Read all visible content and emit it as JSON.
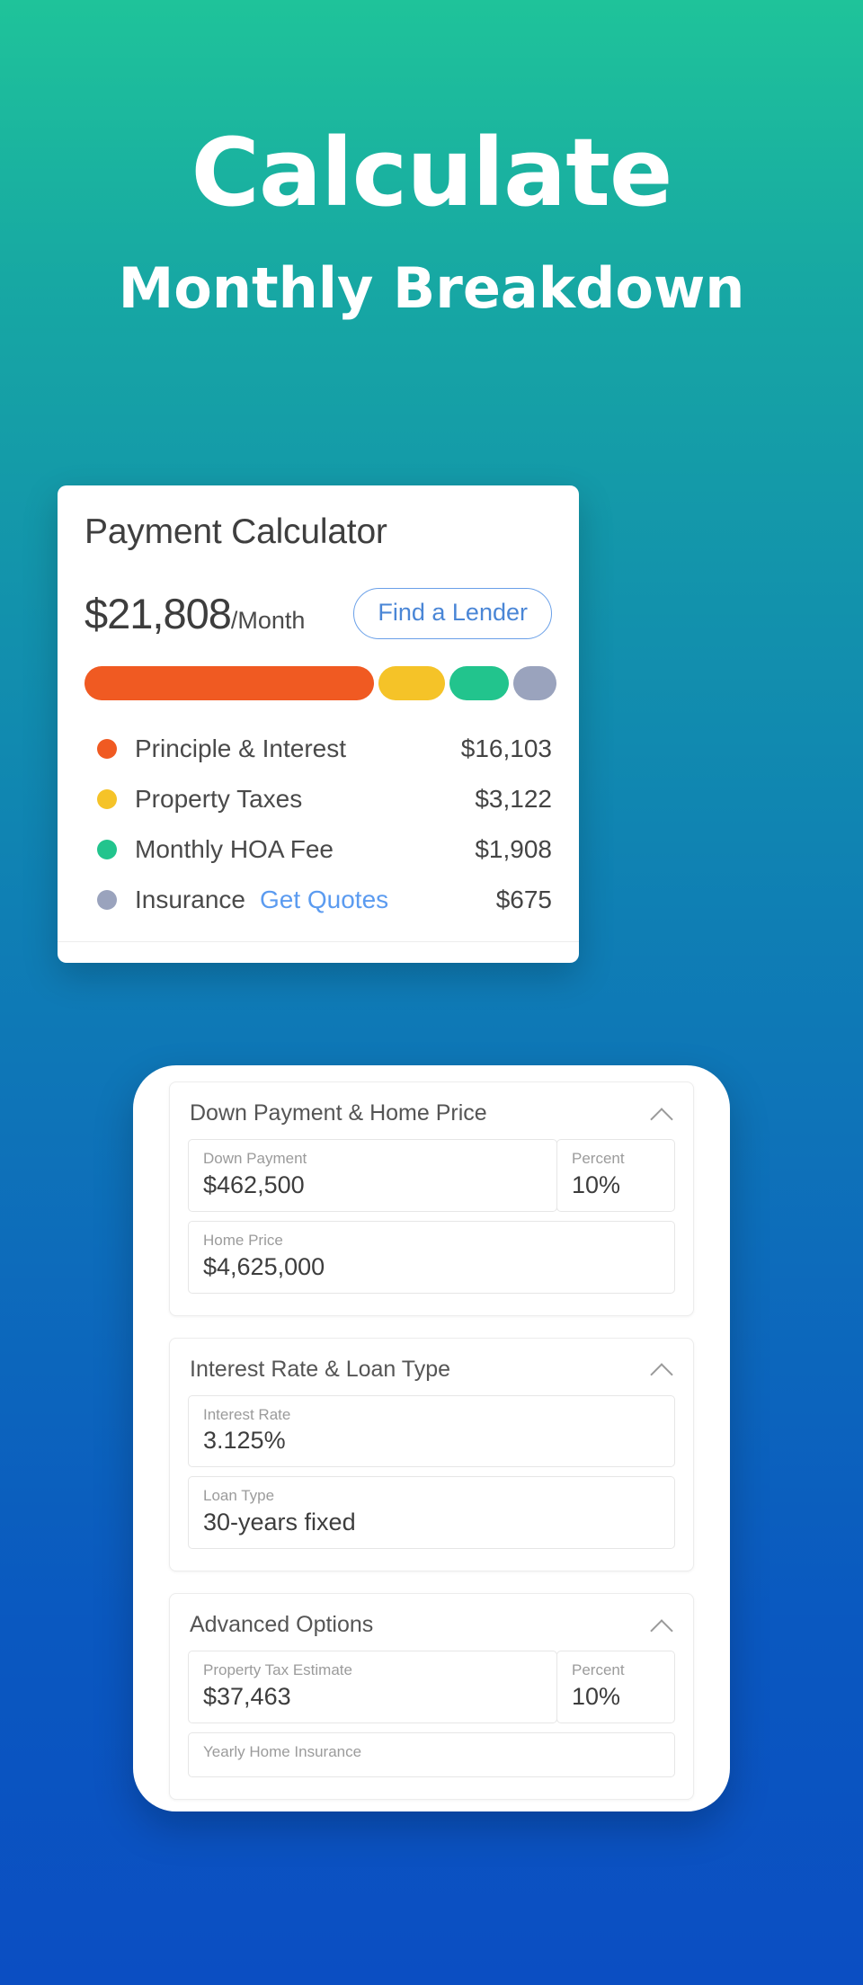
{
  "hero": {
    "line1": "Calculate",
    "line2": "Monthly Breakdown"
  },
  "card": {
    "title": "Payment Calculator",
    "amount": "$21,808",
    "amount_suffix": "/Month",
    "lender_button": "Find a Lender",
    "bar_segments": [
      {
        "color": "#f05a22",
        "width_pct": 62.0
      },
      {
        "color": "#f5c328",
        "width_pct": 14.2
      },
      {
        "color": "#22c48d",
        "width_pct": 12.6
      },
      {
        "color": "#9aa3bd",
        "width_pct": 9.2
      }
    ],
    "legend": [
      {
        "color": "#f05a22",
        "label": "Principle & Interest",
        "link": "",
        "value": "$16,103"
      },
      {
        "color": "#f5c328",
        "label": "Property Taxes",
        "link": "",
        "value": "$3,122"
      },
      {
        "color": "#22c48d",
        "label": "Monthly HOA Fee",
        "link": "",
        "value": "$1,908"
      },
      {
        "color": "#9aa3bd",
        "label": "Insurance",
        "link": "Get Quotes",
        "value": "$675"
      }
    ]
  },
  "phone": {
    "sections": [
      {
        "title": "Down Payment & Home Price",
        "rows": [
          {
            "fields": [
              {
                "label": "Down Payment",
                "value": "$462,500",
                "size": "wide"
              },
              {
                "label": "Percent",
                "value": "10%",
                "size": "small"
              }
            ]
          },
          {
            "fields": [
              {
                "label": "Home Price",
                "value": "$4,625,000",
                "size": "wide"
              }
            ]
          }
        ]
      },
      {
        "title": "Interest Rate & Loan Type",
        "rows": [
          {
            "fields": [
              {
                "label": "Interest Rate",
                "value": "3.125%",
                "size": "wide"
              }
            ]
          },
          {
            "fields": [
              {
                "label": "Loan Type",
                "value": "30-years fixed",
                "size": "wide"
              }
            ]
          }
        ]
      },
      {
        "title": "Advanced Options",
        "rows": [
          {
            "fields": [
              {
                "label": "Property Tax Estimate",
                "value": "$37,463",
                "size": "wide"
              },
              {
                "label": "Percent",
                "value": "10%",
                "size": "small"
              }
            ]
          },
          {
            "fields": [
              {
                "label": "Yearly Home Insurance",
                "value": "",
                "size": "wide"
              }
            ]
          }
        ]
      }
    ]
  },
  "colors": {
    "bg_top": "#1fc39a",
    "bg_bottom": "#0b4ec2",
    "accent_orange": "#f05a22",
    "accent_yellow": "#f5c328",
    "accent_green": "#22c48d",
    "accent_slate": "#9aa3bd",
    "link_blue": "#5b9bf0"
  }
}
